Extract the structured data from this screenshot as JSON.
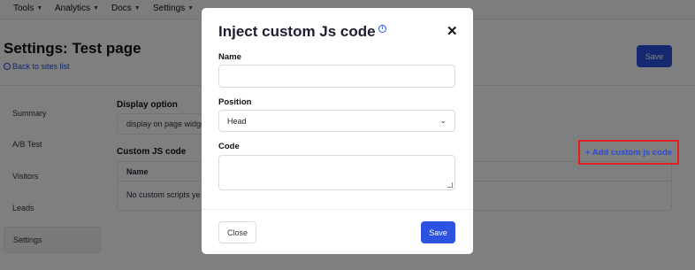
{
  "topnav": {
    "items": [
      {
        "label": "Tools"
      },
      {
        "label": "Analytics"
      },
      {
        "label": "Docs"
      },
      {
        "label": "Settings"
      }
    ]
  },
  "page": {
    "title": "Settings: Test page",
    "back_link": "Back to sites list",
    "save_label": "Save"
  },
  "sidebar": {
    "items": [
      {
        "label": "Summary"
      },
      {
        "label": "A/B Test"
      },
      {
        "label": "Visitors"
      },
      {
        "label": "Leads"
      },
      {
        "label": "Settings",
        "active": true
      }
    ]
  },
  "content": {
    "display_option_label": "Display option",
    "display_option_value": "display on page widge",
    "custom_js_label": "Custom JS code",
    "add_js_label": "+ Add custom js code",
    "table": {
      "header": "Name",
      "empty": "No custom scripts ye"
    }
  },
  "modal": {
    "title": "Inject custom Js code",
    "name_label": "Name",
    "name_value": "",
    "position_label": "Position",
    "position_value": "Head",
    "code_label": "Code",
    "code_value": "",
    "close_label": "Close",
    "save_label": "Save"
  },
  "colors": {
    "primary": "#2b52e0",
    "highlight_border": "#e02020",
    "overlay": "rgba(0,0,0,0.5)"
  }
}
